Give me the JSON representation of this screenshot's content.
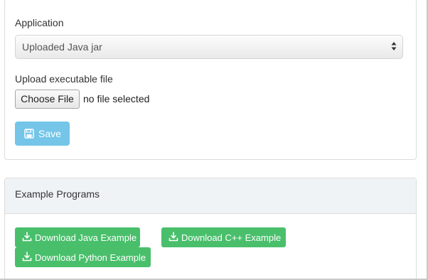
{
  "form": {
    "application_label": "Application",
    "application_value": "Uploaded Java jar",
    "upload_label": "Upload executable file",
    "choose_file_label": "Choose File",
    "file_status": "no file selected",
    "save_label": "Save"
  },
  "examples": {
    "title": "Example Programs",
    "buttons": [
      {
        "label": "Download Java Example",
        "icon": "download-icon"
      },
      {
        "label": "Download C++ Example",
        "icon": "download-icon"
      },
      {
        "label": "Download Python Example",
        "icon": "download-icon"
      }
    ]
  },
  "colors": {
    "save_button": "#74c5e8",
    "download_button": "#49bf6b",
    "panel_header": "#f0f3f6"
  }
}
